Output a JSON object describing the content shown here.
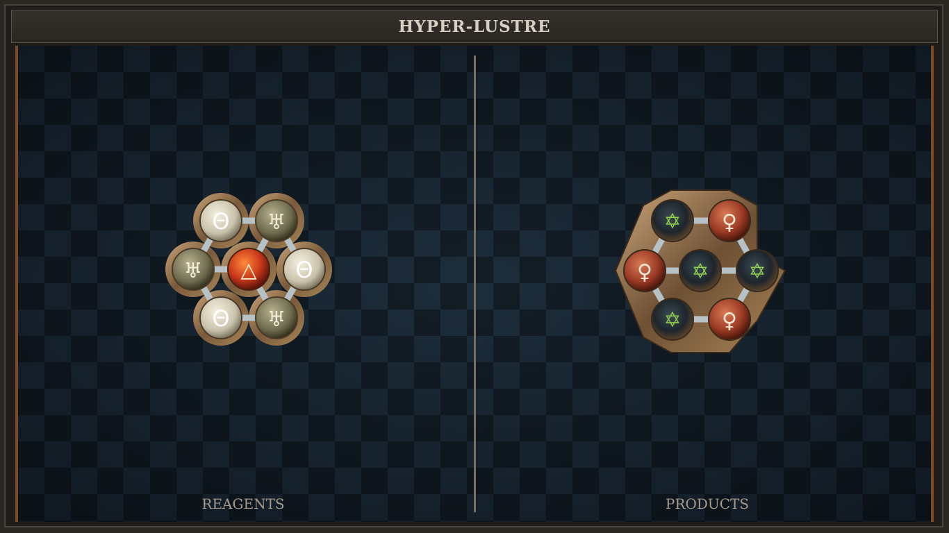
{
  "title": "HYPER-LUSTRE",
  "panels": {
    "reagents": {
      "label": "REAGENTS"
    },
    "products": {
      "label": "PRODUCTS"
    }
  },
  "reagent_atoms": [
    {
      "symbol": "Θ",
      "element": "salt"
    },
    {
      "symbol": "♅",
      "element": "quicksilver"
    },
    {
      "symbol": "♅",
      "element": "quicksilver"
    },
    {
      "symbol": "△",
      "element": "fire"
    },
    {
      "symbol": "Θ",
      "element": "salt"
    },
    {
      "symbol": "Θ",
      "element": "salt"
    },
    {
      "symbol": "♅",
      "element": "quicksilver"
    }
  ],
  "product_atoms": [
    {
      "symbol": "✡",
      "element": "vitae-salt"
    },
    {
      "symbol": "♀",
      "element": "copper"
    },
    {
      "symbol": "♀",
      "element": "copper"
    },
    {
      "symbol": "✡",
      "element": "vitae-salt"
    },
    {
      "symbol": "✡",
      "element": "vitae-salt"
    },
    {
      "symbol": "✡",
      "element": "vitae-salt"
    },
    {
      "symbol": "♀",
      "element": "copper"
    }
  ],
  "colors": {
    "salt": "#d9d3c0",
    "quicksilver": "#8f8a6a",
    "fire": "#d0451c",
    "copper": "#a8442a",
    "vitae": "#5b8a2a"
  }
}
